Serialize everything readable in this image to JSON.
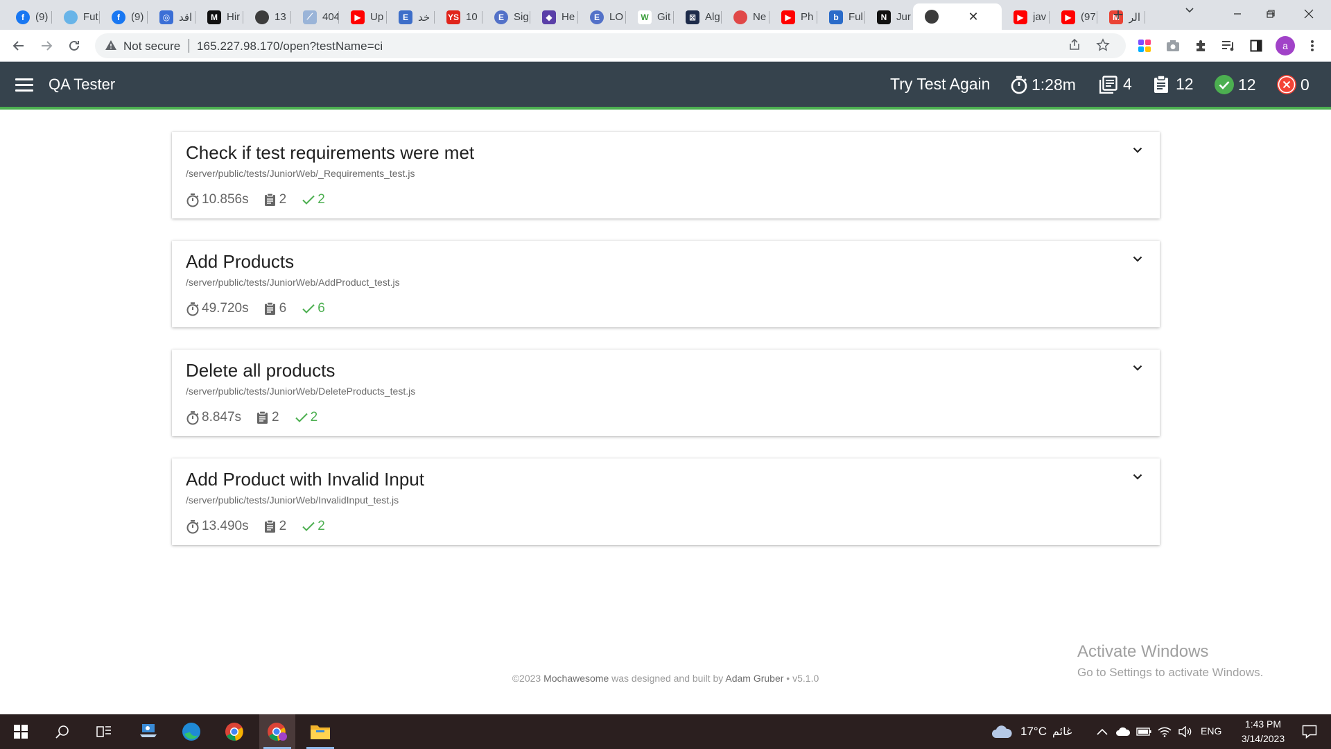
{
  "browser": {
    "tabs": [
      {
        "title": "(9)",
        "icon": "facebook-icon",
        "color": "#1877f2",
        "glyph": "f",
        "round": true
      },
      {
        "title": "Fut",
        "icon": "globe-icon",
        "color": "#68b4e8",
        "glyph": "",
        "round": true
      },
      {
        "title": "(9)",
        "icon": "facebook-icon",
        "color": "#1877f2",
        "glyph": "f",
        "round": true
      },
      {
        "title": "اقد",
        "icon": "target-icon",
        "color": "#3b6fd6",
        "glyph": "◎",
        "round": false
      },
      {
        "title": "Hir",
        "icon": "letter-m-icon",
        "color": "#111111",
        "glyph": "M",
        "round": false
      },
      {
        "title": "13",
        "icon": "globe-icon",
        "color": "#3c3c3c",
        "glyph": "",
        "round": true
      },
      {
        "title": "404",
        "icon": "feather-icon",
        "color": "#9ab4d8",
        "glyph": "⟋",
        "round": false
      },
      {
        "title": "Up",
        "icon": "youtube-icon",
        "color": "#ff0000",
        "glyph": "▶",
        "round": false
      },
      {
        "title": "خد",
        "icon": "letter-e-icon",
        "color": "#3d6ec9",
        "glyph": "E",
        "round": false
      },
      {
        "title": "10",
        "icon": "ys-icon",
        "color": "#e0241b",
        "glyph": "YS",
        "round": false
      },
      {
        "title": "Sig",
        "icon": "letter-e-circle-icon",
        "color": "#5371c8",
        "glyph": "E",
        "round": true
      },
      {
        "title": "He",
        "icon": "puzzle-app-icon",
        "color": "#5a3fa8",
        "glyph": "◆",
        "round": false
      },
      {
        "title": "LO",
        "icon": "letter-e-circle-icon",
        "color": "#5371c8",
        "glyph": "E",
        "round": true
      },
      {
        "title": "Git",
        "icon": "letter-w-icon",
        "color": "#ffffff",
        "glyph": "W",
        "round": false
      },
      {
        "title": "Alg",
        "icon": "x-box-icon",
        "color": "#1d2b4a",
        "glyph": "⊠",
        "round": false
      },
      {
        "title": "Ne",
        "icon": "record-icon",
        "color": "#e04848",
        "glyph": "",
        "round": true
      },
      {
        "title": "Ph",
        "icon": "youtube-icon",
        "color": "#ff0000",
        "glyph": "▶",
        "round": false
      },
      {
        "title": "Ful",
        "icon": "bing-icon",
        "color": "#2a6bc9",
        "glyph": "b",
        "round": false
      },
      {
        "title": "Jur",
        "icon": "notion-icon",
        "color": "#111111",
        "glyph": "N",
        "round": false
      },
      {
        "title": "",
        "icon": "globe-icon",
        "color": "#3c3c3c",
        "glyph": "",
        "round": true,
        "active": true
      },
      {
        "title": "jav",
        "icon": "youtube-icon",
        "color": "#ff0000",
        "glyph": "▶",
        "round": false
      },
      {
        "title": "(97",
        "icon": "youtube-icon",
        "color": "#ff0000",
        "glyph": "▶",
        "round": false
      },
      {
        "title": "الر",
        "icon": "gmail-icon",
        "color": "#ea4335",
        "glyph": "M",
        "round": false
      }
    ],
    "security_label": "Not secure",
    "url": "165.227.98.170/open?testName=ci",
    "profile_initial": "a"
  },
  "app": {
    "title": "QA Tester",
    "try_again": "Try Test Again",
    "duration": "1:28m",
    "suites": "4",
    "tests": "12",
    "passed": "12",
    "failed": "0"
  },
  "suites": [
    {
      "title": "Check if test requirements were met",
      "file": "/server/public/tests/JuniorWeb/_Requirements_test.js",
      "duration": "10.856s",
      "tests": "2",
      "passes": "2"
    },
    {
      "title": "Add Products",
      "file": "/server/public/tests/JuniorWeb/AddProduct_test.js",
      "duration": "49.720s",
      "tests": "6",
      "passes": "6"
    },
    {
      "title": "Delete all products",
      "file": "/server/public/tests/JuniorWeb/DeleteProducts_test.js",
      "duration": "8.847s",
      "tests": "2",
      "passes": "2"
    },
    {
      "title": "Add Product with Invalid Input",
      "file": "/server/public/tests/JuniorWeb/InvalidInput_test.js",
      "duration": "13.490s",
      "tests": "2",
      "passes": "2"
    }
  ],
  "footer": {
    "prefix": "©2023 ",
    "brand": "Mochawesome",
    "middle": " was designed and built by ",
    "author": "Adam Gruber",
    "version": " • v5.1.0"
  },
  "watermark": {
    "line1": "Activate Windows",
    "line2": "Go to Settings to activate Windows."
  },
  "taskbar": {
    "temperature": "17°C",
    "weather": "غائم",
    "language": "ENG",
    "time": "1:43 PM",
    "date": "3/14/2023"
  },
  "colors": {
    "navbar": "#36434d",
    "pass": "#4caf50",
    "fail": "#f44336",
    "accent_line": "#4caf50"
  }
}
